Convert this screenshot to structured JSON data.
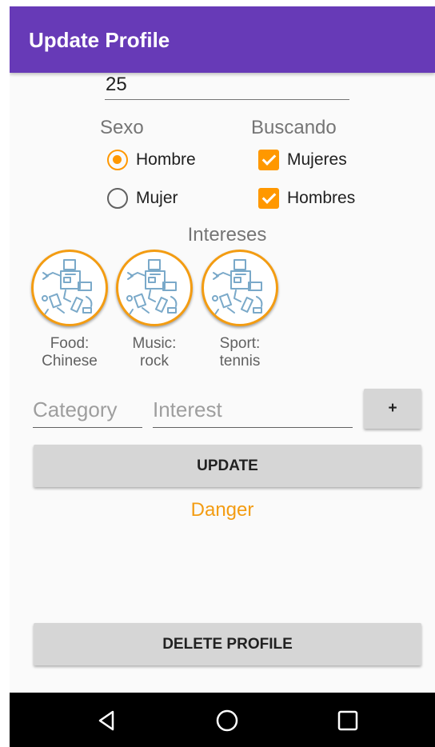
{
  "app_bar": {
    "title": "Update Profile"
  },
  "age": {
    "value": "25"
  },
  "sexo": {
    "title": "Sexo",
    "options": [
      {
        "label": "Hombre",
        "selected": true
      },
      {
        "label": "Mujer",
        "selected": false
      }
    ]
  },
  "buscando": {
    "title": "Buscando",
    "options": [
      {
        "label": "Mujeres",
        "checked": true
      },
      {
        "label": "Hombres",
        "checked": true
      }
    ]
  },
  "intereses": {
    "title": "Intereses",
    "items": [
      {
        "category": "Food:",
        "interest": "Chinese",
        "icon": "robot-parts-icon"
      },
      {
        "category": "Music:",
        "interest": "rock",
        "icon": "robot-parts-icon"
      },
      {
        "category": "Sport:",
        "interest": "tennis",
        "icon": "robot-parts-icon"
      }
    ]
  },
  "add_interest": {
    "category_placeholder": "Category",
    "interest_placeholder": "Interest",
    "add_label": "+"
  },
  "actions": {
    "update_label": "UPDATE",
    "danger_label": "Danger",
    "delete_label": "DELETE PROFILE"
  },
  "colors": {
    "app_bar": "#673ab7",
    "accent": "#ff9800",
    "danger_text": "#f39c12",
    "button": "#d6d6d6"
  },
  "nav_bar": {
    "icons": [
      "back-icon",
      "home-icon",
      "recents-icon"
    ]
  }
}
